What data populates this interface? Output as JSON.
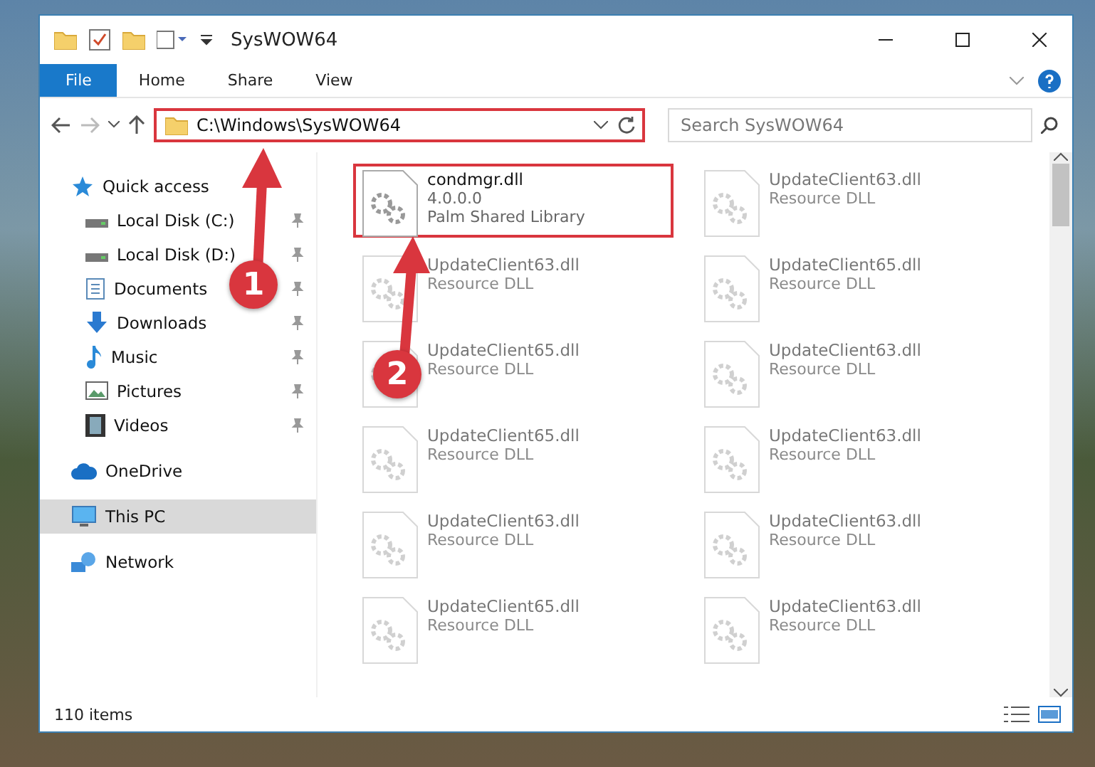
{
  "window": {
    "title": "SysWOW64"
  },
  "ribbon": {
    "tabs": [
      {
        "label": "File",
        "kind": "file"
      },
      {
        "label": "Home",
        "kind": "tab"
      },
      {
        "label": "Share",
        "kind": "tab"
      },
      {
        "label": "View",
        "kind": "tab"
      }
    ]
  },
  "address": {
    "path": "C:\\Windows\\SysWOW64",
    "highlighted": true
  },
  "search": {
    "placeholder": "Search SysWOW64"
  },
  "sidebar": {
    "items": [
      {
        "label": "Quick access",
        "kind": "star",
        "selected": false,
        "children": [
          {
            "label": "Local Disk (C:)",
            "kind": "drive",
            "pinned": true,
            "selected": false
          },
          {
            "label": "Local Disk (D:)",
            "kind": "drive",
            "pinned": true,
            "selected": false
          },
          {
            "label": "Documents",
            "kind": "document",
            "pinned": true,
            "selected": false
          },
          {
            "label": "Downloads",
            "kind": "download",
            "pinned": true,
            "selected": false
          },
          {
            "label": "Music",
            "kind": "music",
            "pinned": true,
            "selected": false
          },
          {
            "label": "Pictures",
            "kind": "picture",
            "pinned": true,
            "selected": false
          },
          {
            "label": "Videos",
            "kind": "video",
            "pinned": true,
            "selected": false
          }
        ]
      },
      {
        "label": "OneDrive",
        "kind": "cloud",
        "selected": false
      },
      {
        "label": "This PC",
        "kind": "computer",
        "selected": true
      },
      {
        "label": "Network",
        "kind": "network",
        "selected": false
      }
    ]
  },
  "files": [
    {
      "name": "condmgr.dll",
      "version": "4.0.0.0",
      "type": "Palm Shared Library",
      "highlighted": true,
      "blurred": false
    },
    {
      "name": "UpdateClient63.dll",
      "type": "Resource DLL",
      "highlighted": false,
      "blurred": true
    },
    {
      "name": "UpdateClient63.dll",
      "type": "Resource DLL",
      "highlighted": false,
      "blurred": true
    },
    {
      "name": "UpdateClient65.dll",
      "type": "Resource DLL",
      "highlighted": false,
      "blurred": true
    },
    {
      "name": "UpdateClient65.dll",
      "type": "Resource DLL",
      "highlighted": false,
      "blurred": true
    },
    {
      "name": "UpdateClient63.dll",
      "type": "Resource DLL",
      "highlighted": false,
      "blurred": true
    },
    {
      "name": "UpdateClient65.dll",
      "type": "Resource DLL",
      "highlighted": false,
      "blurred": true
    },
    {
      "name": "UpdateClient63.dll",
      "type": "Resource DLL",
      "highlighted": false,
      "blurred": true
    },
    {
      "name": "UpdateClient63.dll",
      "type": "Resource DLL",
      "highlighted": false,
      "blurred": true
    },
    {
      "name": "UpdateClient63.dll",
      "type": "Resource DLL",
      "highlighted": false,
      "blurred": true
    },
    {
      "name": "UpdateClient65.dll",
      "type": "Resource DLL",
      "highlighted": false,
      "blurred": true
    },
    {
      "name": "UpdateClient63.dll",
      "type": "Resource DLL",
      "highlighted": false,
      "blurred": true
    }
  ],
  "annotations": [
    {
      "label": "1"
    },
    {
      "label": "2"
    }
  ],
  "status_bar": {
    "count": "110 items"
  }
}
